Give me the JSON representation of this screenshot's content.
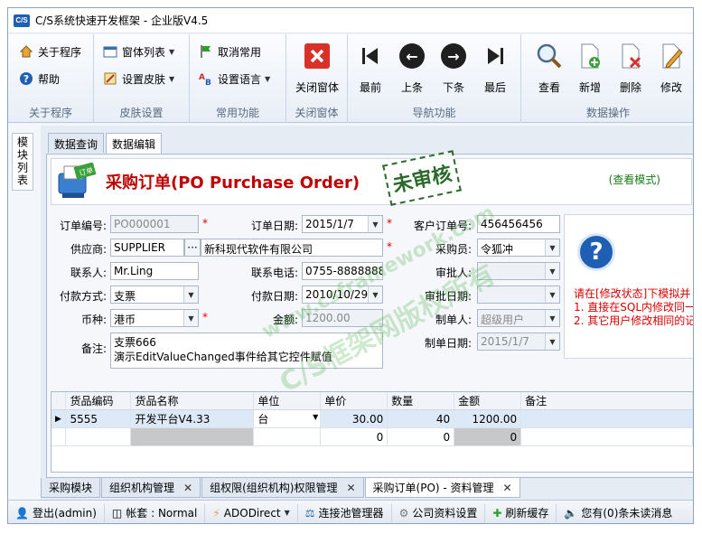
{
  "window": {
    "title": "C/S系统快速开发框架 - 企业版V4.5",
    "icon_text": "C/S"
  },
  "ribbon": {
    "groups": [
      {
        "label": "关于程序",
        "items": [
          "关于程序",
          "帮助"
        ]
      },
      {
        "label": "皮肤设置",
        "items": [
          "窗体列表",
          "设置皮肤"
        ]
      },
      {
        "label": "常用功能",
        "items": [
          "取消常用",
          "设置语言"
        ]
      },
      {
        "label": "关闭窗体",
        "items": [
          "关闭窗体"
        ]
      },
      {
        "label": "导航功能",
        "items": [
          "最前",
          "上条",
          "下条",
          "最后"
        ]
      },
      {
        "label": "数据操作",
        "items": [
          "查看",
          "新增",
          "删除",
          "修改"
        ]
      }
    ]
  },
  "side_tab": "模块列表",
  "tabs": [
    "数据查询",
    "数据编辑"
  ],
  "form": {
    "title": "采购订单(PO Purchase Order)",
    "logo_text": "订单",
    "stamp": "未审核",
    "view_mode": "(查看模式)",
    "fields": {
      "order_no": {
        "label": "订单编号:",
        "value": "PO000001"
      },
      "order_date": {
        "label": "订单日期:",
        "value": "2015/1/7"
      },
      "customer_order_no": {
        "label": "客户订单号:",
        "value": "456456456"
      },
      "supplier": {
        "label": "供应商:",
        "code": "SUPPLIER",
        "name": "新科现代软件有限公司",
        "btn": "···"
      },
      "buyer": {
        "label": "采购员:",
        "value": "令狐冲"
      },
      "contact": {
        "label": "联系人:",
        "value": "Mr.Ling"
      },
      "phone": {
        "label": "联系电话:",
        "value": "0755-88888888"
      },
      "approver": {
        "label": "审批人:",
        "value": ""
      },
      "pay_method": {
        "label": "付款方式:",
        "value": "支票"
      },
      "pay_date": {
        "label": "付款日期:",
        "value": "2010/10/29"
      },
      "approve_date": {
        "label": "审批日期:",
        "value": ""
      },
      "currency": {
        "label": "币种:",
        "value": "港币"
      },
      "amount": {
        "label": "金额:",
        "value": "1200.00"
      },
      "creator": {
        "label": "制单人:",
        "value": "超级用户"
      },
      "remark": {
        "label": "备注:",
        "line1": "支票666",
        "line2": "演示EditValueChanged事件给其它控件赋值"
      },
      "create_date": {
        "label": "制单日期:",
        "value": "2015/1/7"
      }
    },
    "help": {
      "line1": "请在[修改状态]下模拟并",
      "line2": "1. 直接在SQL内修改同一",
      "line3": "2. 其它用户修改相同的记"
    }
  },
  "grid": {
    "columns": [
      "货品编码",
      "货品名称",
      "单位",
      "单价",
      "数量",
      "金额",
      "备注"
    ],
    "rows": [
      {
        "code": "5555",
        "name": "开发平台V4.33",
        "unit": "台",
        "price": "30.00",
        "qty": "40",
        "amount": "1200.00",
        "note": ""
      },
      {
        "code": "",
        "name": "",
        "unit": "",
        "price": "0",
        "qty": "0",
        "amount": "0",
        "note": ""
      }
    ]
  },
  "bottom_tabs": [
    {
      "label": "采购模块",
      "closable": false
    },
    {
      "label": "组织机构管理",
      "closable": true
    },
    {
      "label": "组权限(组织机构)权限管理",
      "closable": true
    },
    {
      "label": "采购订单(PO) - 资料管理",
      "closable": true
    }
  ],
  "statusbar": {
    "logout": "登出(admin)",
    "account": "帐套 : Normal",
    "ado": "ADODirect",
    "pool": "连接池管理器",
    "company": "公司资料设置",
    "refresh": "刷新缓存",
    "messages": "您有(0)条未读消息"
  },
  "watermark": {
    "line1": "C/S框架网版权所有",
    "line2": "www.csframework.com"
  },
  "colors": {
    "title_red": "#c00000",
    "accent_blue": "#1e5fb4",
    "stamp_green": "#2b6a2b"
  }
}
